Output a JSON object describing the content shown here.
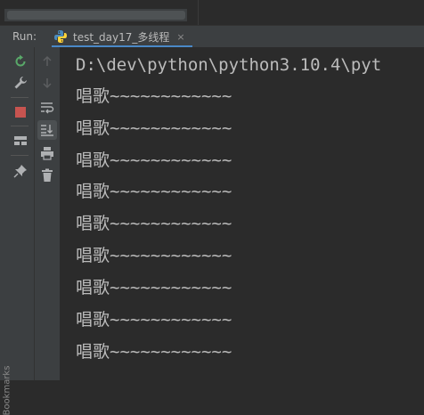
{
  "run_panel": {
    "label": "Run:",
    "tab": {
      "title": "test_day17_多线程",
      "close": "×"
    }
  },
  "toolbar_left": [
    {
      "name": "rerun-icon"
    },
    {
      "name": "wrench-icon"
    },
    {
      "name": "stop-icon",
      "color": "#c75450"
    },
    {
      "name": "layout-icon"
    },
    {
      "name": "pin-icon"
    }
  ],
  "toolbar_right": [
    {
      "name": "up-arrow-icon"
    },
    {
      "name": "down-arrow-icon"
    },
    {
      "name": "soft-wrap-icon"
    },
    {
      "name": "scroll-to-end-icon"
    },
    {
      "name": "print-icon"
    },
    {
      "name": "trash-icon"
    }
  ],
  "bookmarks_label": "Bookmarks",
  "console": {
    "command": "D:\\dev\\python\\python3.10.4\\pyt",
    "lines": [
      "唱歌~~~~~~~~~~~~",
      "唱歌~~~~~~~~~~~~",
      "唱歌~~~~~~~~~~~~",
      "唱歌~~~~~~~~~~~~",
      "唱歌~~~~~~~~~~~~",
      "唱歌~~~~~~~~~~~~",
      "唱歌~~~~~~~~~~~~",
      "唱歌~~~~~~~~~~~~",
      "唱歌~~~~~~~~~~~~"
    ]
  }
}
